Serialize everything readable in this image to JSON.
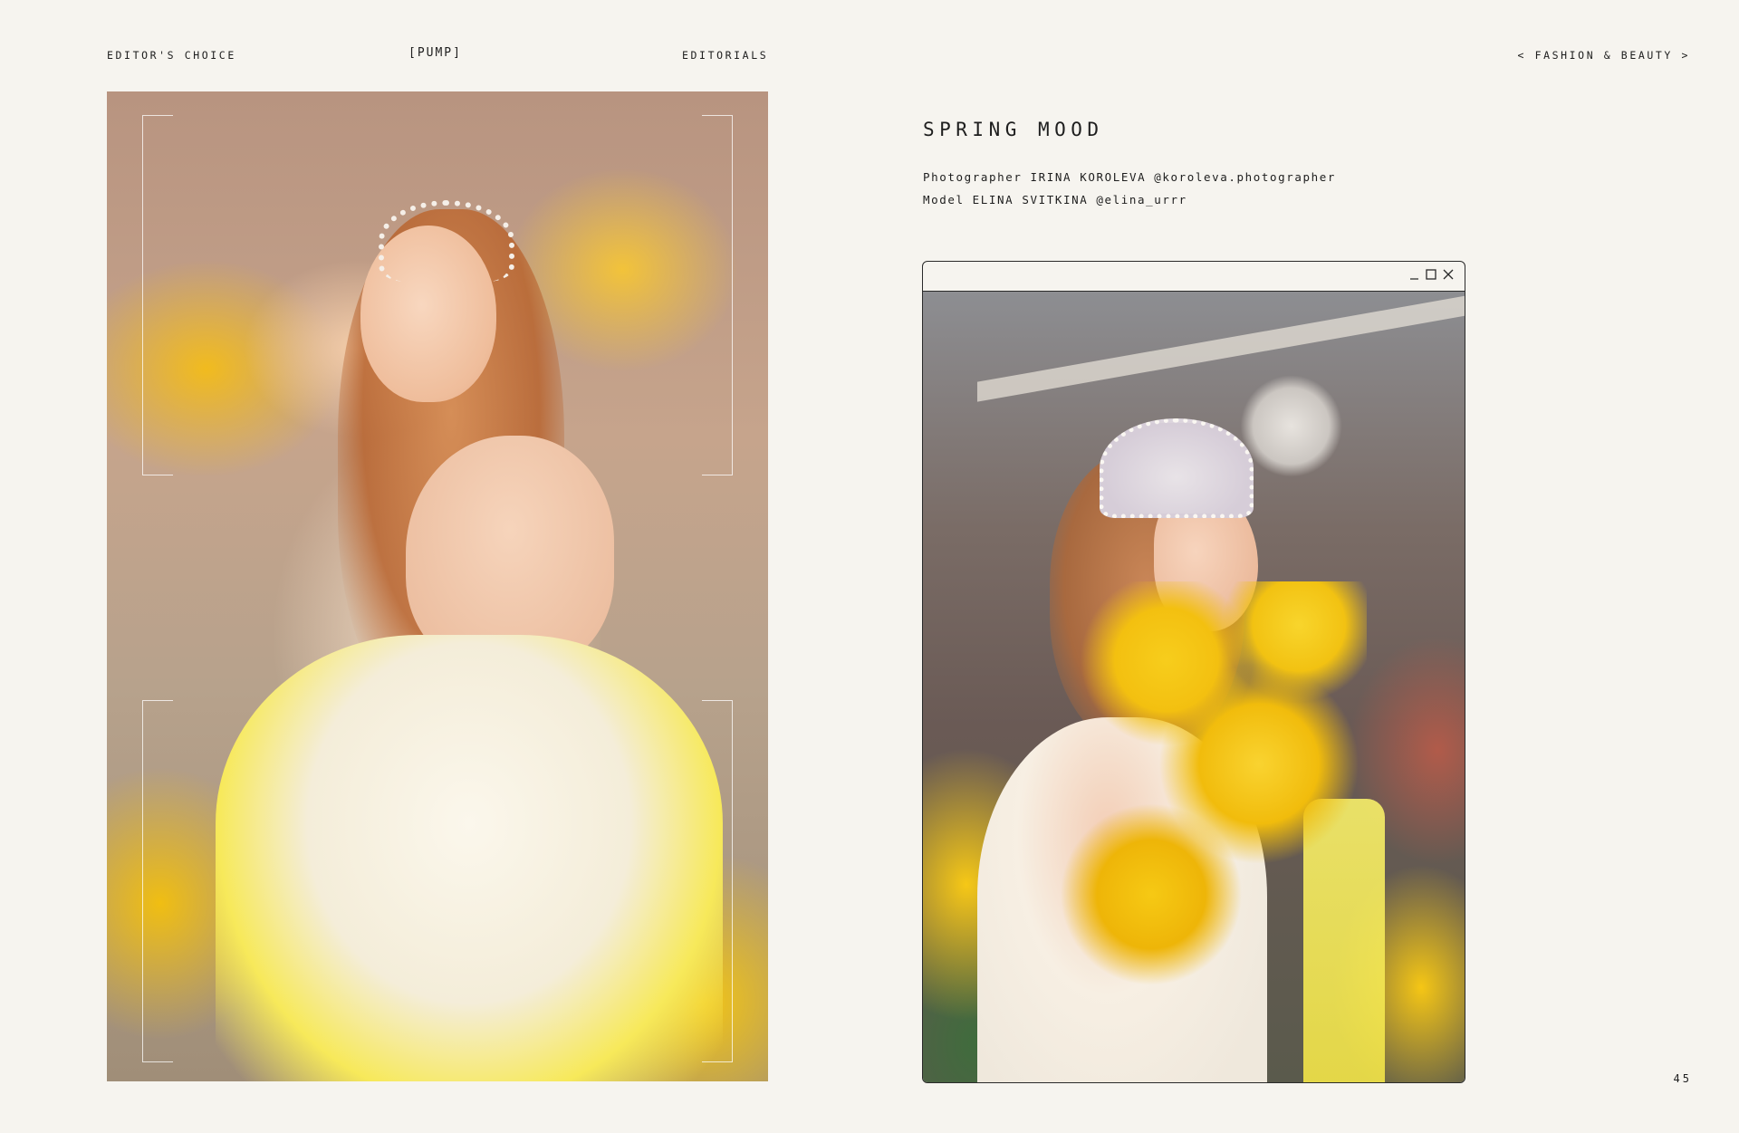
{
  "header": {
    "left": "EDITOR'S CHOICE",
    "center": "[PUMP]",
    "mid": "EDITORIALS",
    "right": "< FASHION & BEAUTY >"
  },
  "article": {
    "title": "SPRING MOOD",
    "credits": {
      "photographer_label": "Photographer",
      "photographer_name": "IRINA KOROLEVA",
      "photographer_handle": "@koroleva.photographer",
      "model_label": "Model",
      "model_name": "ELINA SVITKINA",
      "model_handle": "@elina_urrr"
    }
  },
  "window": {
    "controls": [
      "minimize-icon",
      "maximize-icon",
      "close-icon"
    ]
  },
  "page_number": "45",
  "colors": {
    "background": "#f6f4ef",
    "text": "#1e1e1e",
    "flower_yellow": "#f3c010"
  }
}
